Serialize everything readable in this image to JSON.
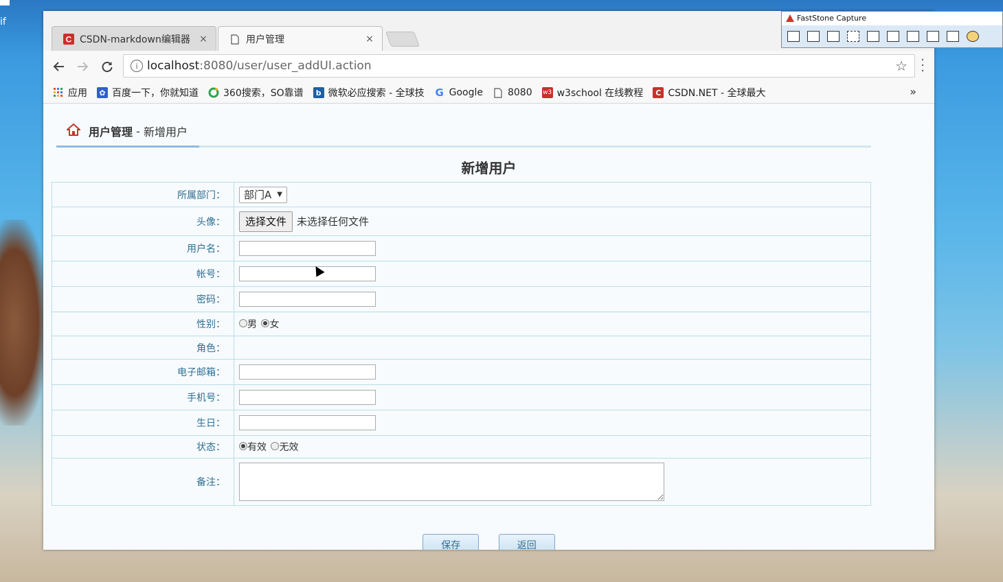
{
  "desktop": {
    "left_label": "if"
  },
  "tabs": [
    {
      "title": "CSDN-markdown编辑器",
      "close": "×",
      "icon": "csdn-icon"
    },
    {
      "title": "用户管理",
      "close": "×",
      "icon": "page-icon"
    }
  ],
  "address": {
    "host": "localhost",
    "path": ":8080/user/user_addUI.action"
  },
  "bookmarks": [
    {
      "label": "应用",
      "icon": "apps-grid-icon"
    },
    {
      "label": "百度一下，你就知道",
      "icon": "baidu-paw-icon"
    },
    {
      "label": "360搜索，SO靠谱",
      "icon": "360-icon"
    },
    {
      "label": "微软必应搜索 - 全球技",
      "icon": "bing-icon"
    },
    {
      "label": "Google",
      "icon": "google-icon"
    },
    {
      "label": "8080",
      "icon": "page-icon"
    },
    {
      "label": "w3school 在线教程",
      "icon": "w3school-icon"
    },
    {
      "label": "CSDN.NET - 全球最大",
      "icon": "csdn-icon"
    }
  ],
  "bookmarks_more": "»",
  "breadcrumb": {
    "section": "用户管理",
    "sep": " - ",
    "page": "新增用户"
  },
  "form": {
    "title": "新增用户",
    "dept_label": "所属部门：",
    "dept_value": "部门A",
    "avatar_label": "头像：",
    "file_button": "选择文件",
    "file_note": "未选择任何文件",
    "username_label": "用户名：",
    "account_label": "帐号：",
    "password_label": "密码：",
    "gender_label": "性别：",
    "gender_male": "男",
    "gender_female": "女",
    "role_label": "角色：",
    "email_label": "电子邮箱：",
    "phone_label": "手机号：",
    "birthday_label": "生日：",
    "status_label": "状态：",
    "status_valid": "有效",
    "status_invalid": "无效",
    "remark_label": "备注："
  },
  "buttons": {
    "save": "保存",
    "back": "返回"
  },
  "faststone": {
    "title": "FastStone Capture"
  },
  "colors": {
    "accent": "#2f6e92",
    "border": "#b9dce8",
    "csdn_red": "#c9302c"
  }
}
